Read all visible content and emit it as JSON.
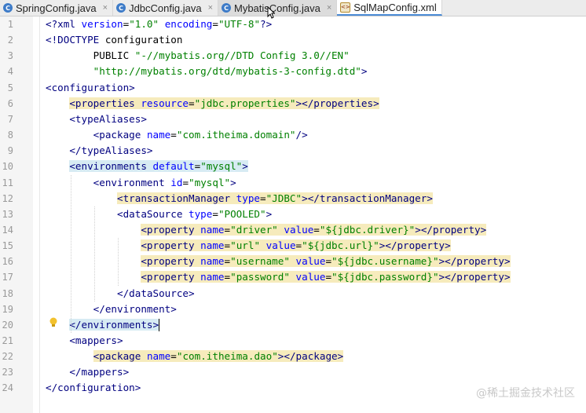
{
  "tabs": [
    {
      "label": "SpringConfig.java",
      "type": "java",
      "active": false
    },
    {
      "label": "JdbcConfig.java",
      "type": "java",
      "active": false
    },
    {
      "label": "MybatisConfig.java",
      "type": "java",
      "active": false
    },
    {
      "label": "SqlMapConfig.xml",
      "type": "xml",
      "active": true
    }
  ],
  "tab_close_glyph": "×",
  "editor": {
    "lines": [
      "<?xml version=\"1.0\" encoding=\"UTF-8\"?>",
      "<!DOCTYPE configuration",
      "        PUBLIC \"-//mybatis.org//DTD Config 3.0//EN\"",
      "        \"http://mybatis.org/dtd/mybatis-3-config.dtd\">",
      "<configuration>",
      "    <properties resource=\"jdbc.properties\"></properties>",
      "    <typeAliases>",
      "        <package name=\"com.itheima.domain\"/>",
      "    </typeAliases>",
      "    <environments default=\"mysql\">",
      "        <environment id=\"mysql\">",
      "            <transactionManager type=\"JDBC\"></transactionManager>",
      "            <dataSource type=\"POOLED\">",
      "                <property name=\"driver\" value=\"${jdbc.driver}\"></property>",
      "                <property name=\"url\" value=\"${jdbc.url}\"></property>",
      "                <property name=\"username\" value=\"${jdbc.username}\"></property>",
      "                <property name=\"password\" value=\"${jdbc.password}\"></property>",
      "            </dataSource>",
      "        </environment>",
      "    </environments>",
      "    <mappers>",
      "        <package name=\"com.itheima.dao\"></package>",
      "    </mappers>",
      "</configuration>"
    ]
  },
  "watermark": "@稀土掘金技术社区",
  "colors": {
    "highlight": "#f6ebbc",
    "match_highlight": "#d7ebf3",
    "tag": "#000080",
    "attribute": "#0000ff",
    "value": "#008000"
  }
}
